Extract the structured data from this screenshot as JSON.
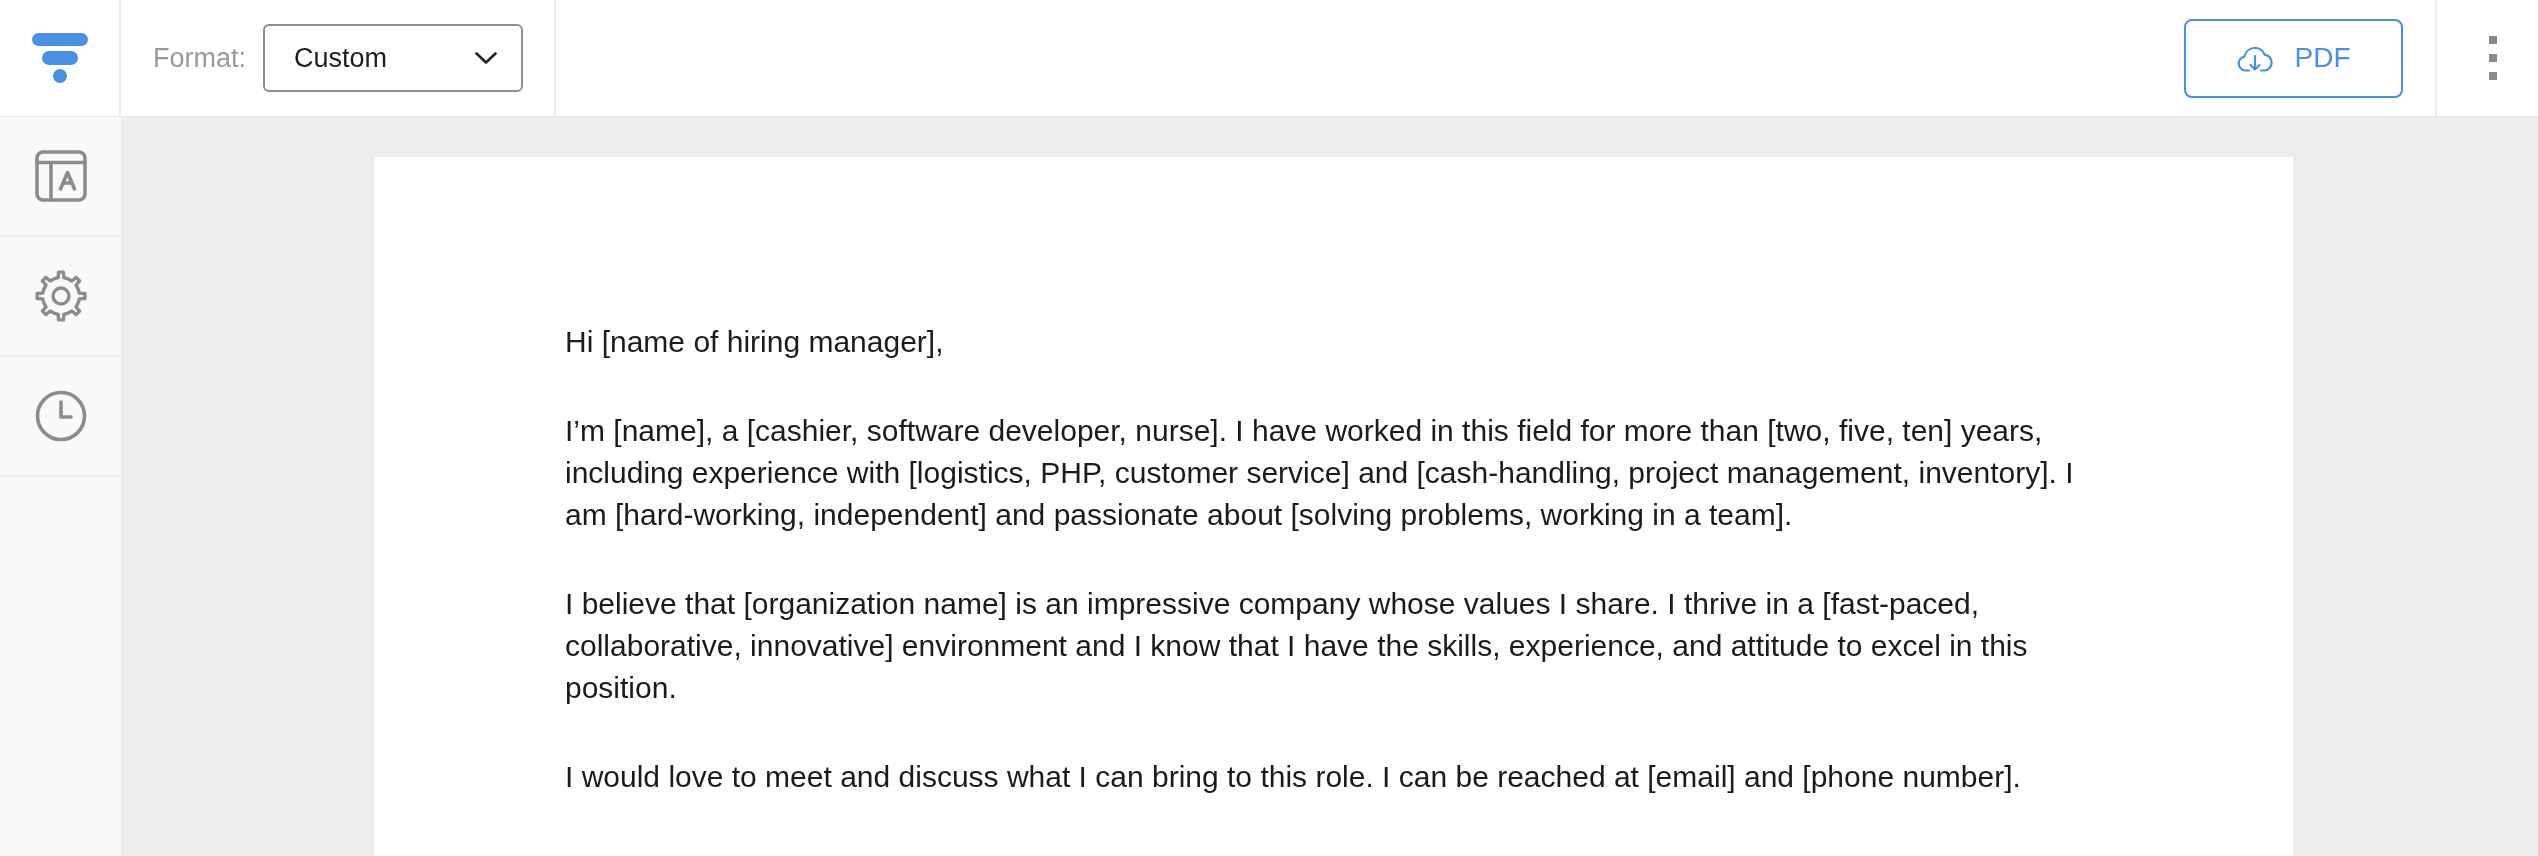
{
  "toolbar": {
    "format_label": "Format:",
    "format_value": "Custom",
    "export_button": "PDF"
  },
  "document": {
    "greeting": "Hi [name of hiring manager],",
    "paragraphs": [
      "I’m [name], a [cashier, software developer, nurse]. I have worked in this field for more than [two, five, ten] years, including experience with [logistics, PHP, customer service] and [cash-handling, project management, inventory]. I am [hard-working, independent] and passionate about [solving problems, working in a team].",
      "I believe that [organization name] is an impressive company whose values I share. I thrive in a [fast-paced, collaborative, innovative] environment and I know that I have the skills, experience, and attitude to excel in this position.",
      "I would love to meet and discuss what I can bring to this role. I can be reached at [email] and [phone number]."
    ]
  }
}
